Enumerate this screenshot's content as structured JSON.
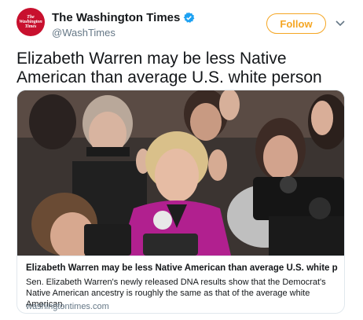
{
  "account": {
    "name": "The Washington Times",
    "handle": "@WashTimes",
    "avatar_text": "The Washington Times",
    "follow_label": "Follow"
  },
  "tweet": {
    "text": "Elizabeth Warren may be less Native American than average U.S. white person"
  },
  "card": {
    "title": "Elizabeth Warren may be less Native American than average U.S. white p",
    "description": "Sen. Elizabeth Warren's newly released DNA results show that the Democrat's Native American ancestry is roughly the same as that of the average white American,",
    "domain": "washingtontimes.com"
  },
  "colors": {
    "follow_accent": "#f5a623",
    "verified": "#1da1f2",
    "avatar_bg": "#c8102e",
    "secondary_text": "#657786"
  },
  "icons": [
    "verified-badge-icon",
    "chevron-down-icon"
  ]
}
